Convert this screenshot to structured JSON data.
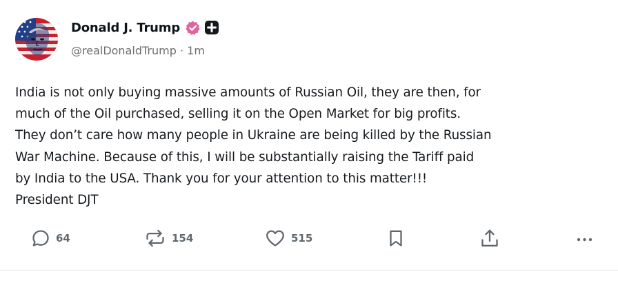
{
  "author": {
    "display_name": "Donald J. Trump",
    "handle": "@realDonaldTrump",
    "separator": "·",
    "time_ago": "1m"
  },
  "post": {
    "lines": [
      "India is not only buying massive amounts of Russian Oil, they are then, for",
      "much of the Oil purchased, selling it on the Open Market for big profits.",
      "They don’t care how many people in Ukraine are being killed by the Russian",
      "War Machine. Because of this, I will be substantially raising the Tariff paid",
      "by India to the USA. Thank you for your attention to this matter!!!",
      "President DJT"
    ]
  },
  "actions": {
    "reply_count": "64",
    "retruth_count": "154",
    "like_count": "515"
  },
  "icons": {
    "verified": "verified-badge-icon",
    "plus_badge": "plus-badge-icon",
    "reply": "speech-bubble-icon",
    "retruth": "repost-arrows-icon",
    "like": "heart-icon",
    "bookmark": "bookmark-icon",
    "share": "share-upload-icon",
    "more": "more-dots-icon"
  },
  "colors": {
    "verified_badge": "#e0659e",
    "icon_gray": "#606770",
    "text_primary": "#0f1419",
    "text_secondary": "#6b6e72"
  }
}
